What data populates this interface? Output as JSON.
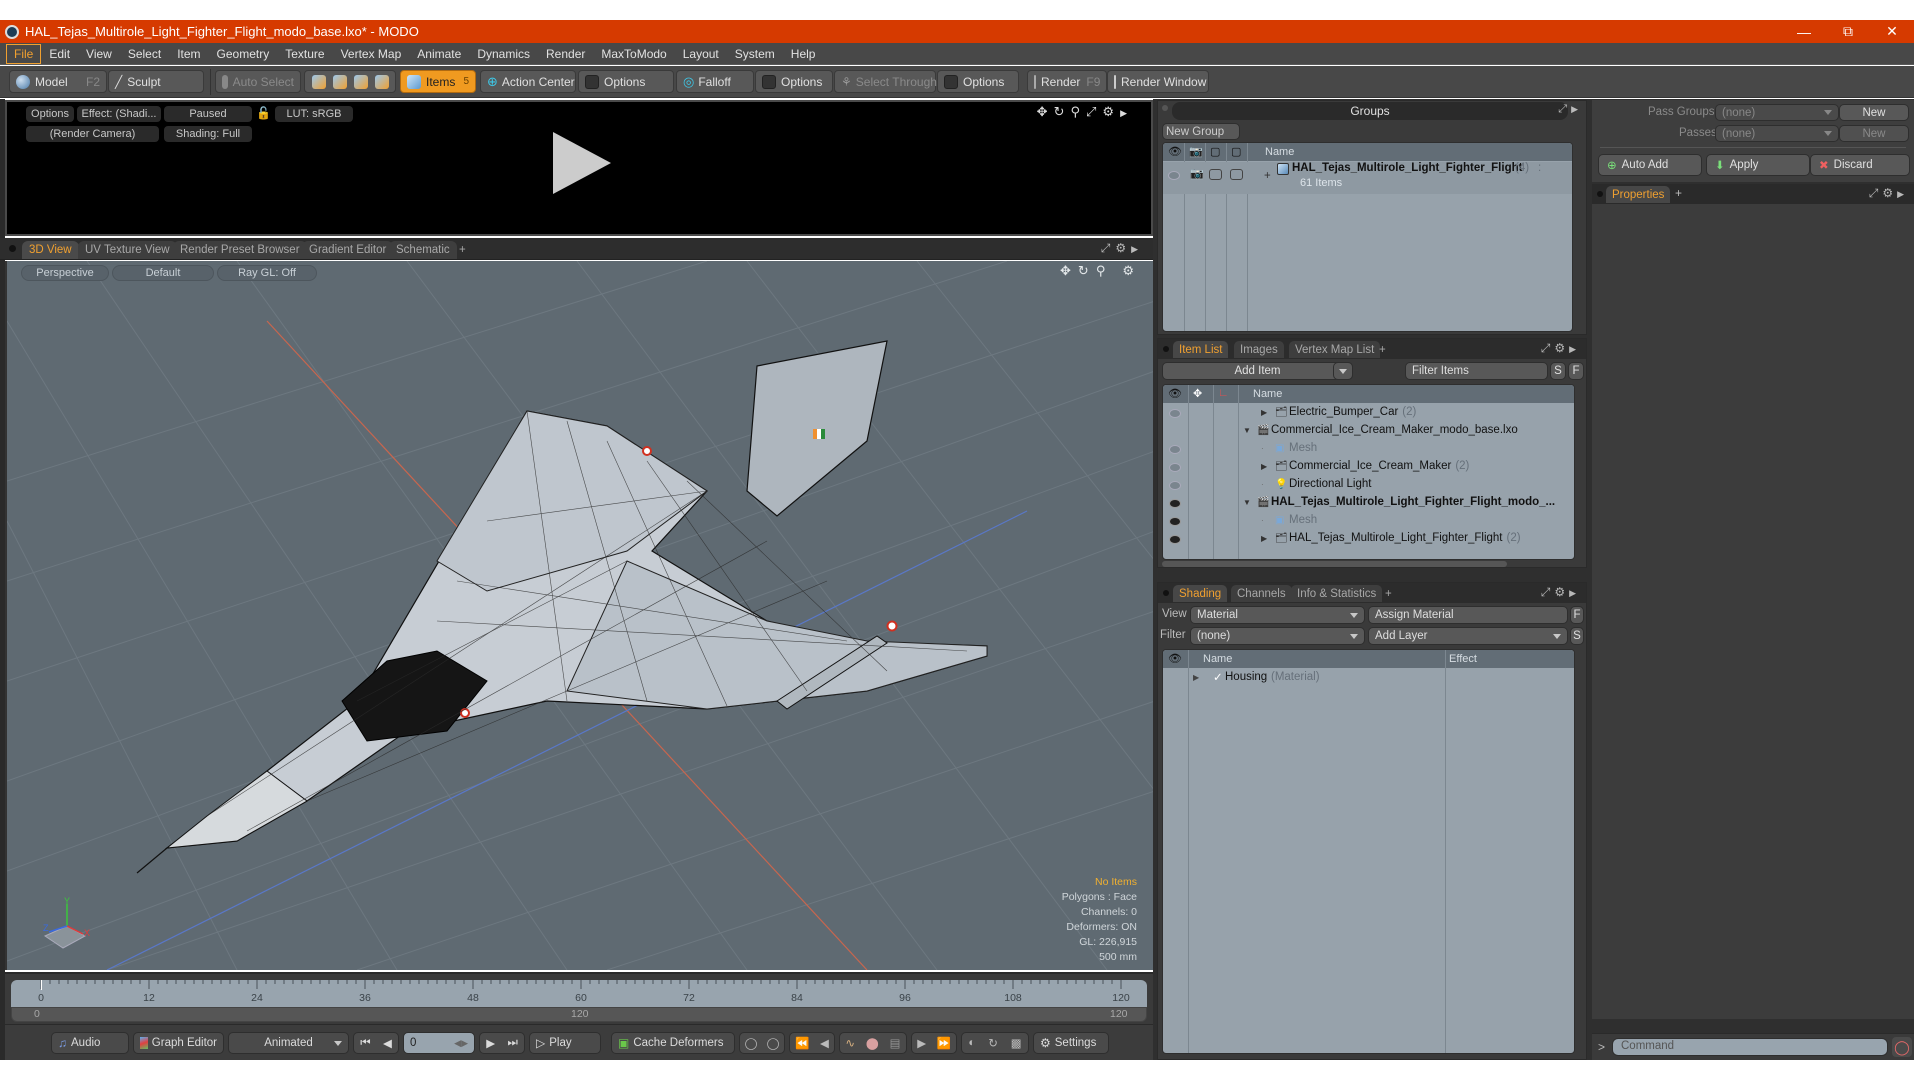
{
  "window": {
    "title": "HAL_Tejas_Multirole_Light_Fighter_Flight_modo_base.lxo* - MODO",
    "controls": [
      "minimize-icon",
      "restore-icon",
      "close-icon"
    ]
  },
  "menu": [
    "File",
    "Edit",
    "View",
    "Select",
    "Item",
    "Geometry",
    "Texture",
    "Vertex Map",
    "Animate",
    "Dynamics",
    "Render",
    "MaxToModo",
    "Layout",
    "System",
    "Help"
  ],
  "menu_active": "File",
  "toolbar": {
    "model": "Model",
    "model_key": "F2",
    "sculpt": "Sculpt",
    "auto_select": "Auto Select",
    "items": "Items",
    "items_count": "5",
    "action_center": "Action Center",
    "options1": "Options",
    "falloff": "Falloff",
    "options2": "Options",
    "select_through": "Select Through",
    "options3": "Options",
    "render": "Render",
    "render_key": "F9",
    "render_window": "Render Window"
  },
  "preview": {
    "options": "Options",
    "effect": "Effect: (Shadi...",
    "paused": "Paused",
    "lut": "LUT: sRGB",
    "camera": "(Render Camera)",
    "shading": "Shading: Full"
  },
  "viewport_tabs": [
    "3D View",
    "UV Texture View",
    "Render Preset Browser",
    "Gradient Editor",
    "Schematic",
    "+"
  ],
  "viewport_active_tab": "3D View",
  "viewport": {
    "projection": "Perspective",
    "style": "Default",
    "raygl": "Ray GL: Off",
    "axis_labels": {
      "x": "X",
      "y": "Y",
      "z": "Z"
    },
    "hud": [
      "No Items",
      "Polygons : Face",
      "Channels: 0",
      "Deformers: ON",
      "GL: 226,915",
      "500 mm"
    ],
    "model_name": "HAL Tejas wireframe model"
  },
  "timeline": {
    "ticks": [
      "0",
      "12",
      "24",
      "36",
      "48",
      "60",
      "72",
      "84",
      "96",
      "108",
      "120"
    ],
    "range_start": "0",
    "range_mid": "120",
    "range_end": "120",
    "current_frame": 0
  },
  "bottombar": {
    "audio": "Audio",
    "graph_editor": "Graph Editor",
    "animated": "Animated",
    "frame_value": "0",
    "play": "Play",
    "cache_deformers": "Cache Deformers",
    "settings": "Settings"
  },
  "groups": {
    "title": "Groups",
    "new_group": "New Group",
    "header_name": "Name",
    "rows": [
      {
        "name": "HAL_Tejas_Multirole_Light_Fighter_Flight",
        "count": "(4)",
        "suffix": ":",
        "sub": "61 Items"
      }
    ]
  },
  "passes": {
    "pass_groups_label": "Pass Groups",
    "pass_groups_value": "(none)",
    "passes_label": "Passes",
    "passes_value": "(none)",
    "new1": "New",
    "new2": "New",
    "auto_add": "Auto Add",
    "apply": "Apply",
    "discard": "Discard"
  },
  "properties": {
    "tab": "Properties",
    "add": "+"
  },
  "itemlist": {
    "tabs": [
      "Item List",
      "Images",
      "Vertex Map List",
      "+"
    ],
    "active_tab": "Item List",
    "add_item": "Add Item",
    "filter_placeholder": "Filter Items",
    "s_btn": "S",
    "f_btn": "F",
    "header_name": "Name",
    "rows": [
      {
        "name": "Electric_Bumper_Car",
        "count": "(2)",
        "indent": 2,
        "type": "folder",
        "bold": false,
        "dim": false,
        "expand": "right",
        "eye": "faint"
      },
      {
        "name": "Commercial_Ice_Cream_Maker_modo_base.lxo",
        "count": "",
        "indent": 1,
        "type": "scene",
        "bold": false,
        "dim": false,
        "expand": "down",
        "eye": "none"
      },
      {
        "name": "Mesh",
        "count": "",
        "indent": 2,
        "type": "mesh",
        "bold": false,
        "dim": true,
        "expand": "none",
        "eye": "faint"
      },
      {
        "name": "Commercial_Ice_Cream_Maker",
        "count": "(2)",
        "indent": 2,
        "type": "folder",
        "bold": false,
        "dim": false,
        "expand": "right",
        "eye": "faint"
      },
      {
        "name": "Directional Light",
        "count": "",
        "indent": 2,
        "type": "light",
        "bold": false,
        "dim": false,
        "expand": "none",
        "eye": "faint"
      },
      {
        "name": "HAL_Tejas_Multirole_Light_Fighter_Flight_modo_...",
        "count": "",
        "indent": 1,
        "type": "scene",
        "bold": true,
        "dim": false,
        "expand": "down",
        "eye": "solid"
      },
      {
        "name": "Mesh",
        "count": "",
        "indent": 2,
        "type": "mesh",
        "bold": false,
        "dim": true,
        "expand": "none",
        "eye": "solid"
      },
      {
        "name": "HAL_Tejas_Multirole_Light_Fighter_Flight",
        "count": "(2)",
        "indent": 2,
        "type": "folder",
        "bold": false,
        "dim": false,
        "expand": "right",
        "eye": "solid"
      }
    ]
  },
  "shading": {
    "tabs": [
      "Shading",
      "Channels",
      "Info & Statistics",
      "+"
    ],
    "active_tab": "Shading",
    "view_label": "View",
    "view_value": "Material",
    "assign_material": "Assign Material",
    "f_btn": "F",
    "filter_label": "Filter",
    "filter_value": "(none)",
    "add_layer": "Add Layer",
    "s_btn": "S",
    "header_name": "Name",
    "header_effect": "Effect",
    "rows": [
      {
        "name": "Housing",
        "type": "(Material)",
        "effect": ""
      }
    ]
  },
  "command": {
    "prompt": ">",
    "placeholder": "Command"
  },
  "colors": {
    "titlebar": "#d63a00",
    "accent": "#f0a030",
    "viewport_bg": "#5f6a72"
  }
}
